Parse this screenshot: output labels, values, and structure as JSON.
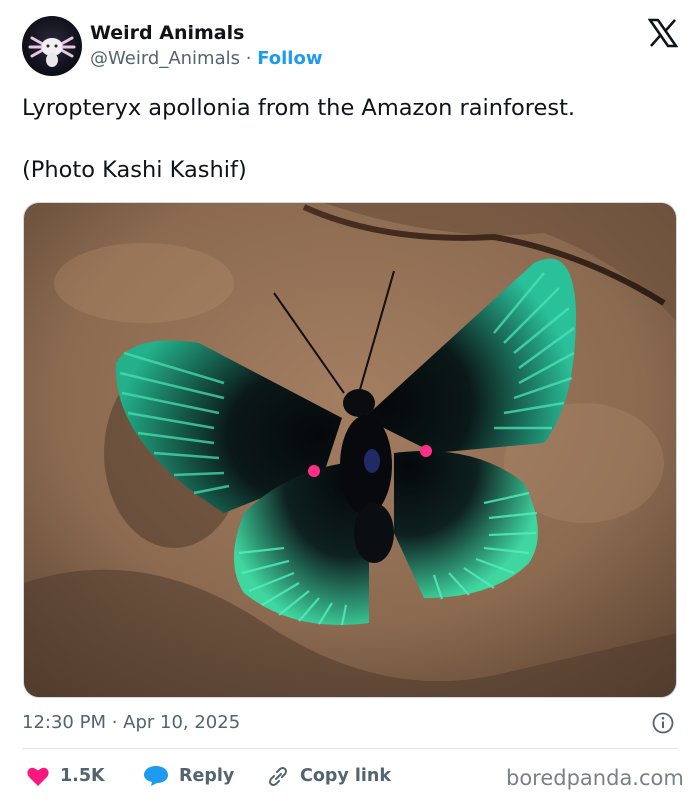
{
  "author": {
    "display_name": "Weird Animals",
    "handle": "@Weird_Animals",
    "separator": "·",
    "follow_label": "Follow"
  },
  "tweet": {
    "text_line_1": "Lyropteryx apollonia from the Amazon rainforest.",
    "text_line_2": "(Photo Kashi Kashif)"
  },
  "meta": {
    "timestamp": "12:30 PM · Apr 10, 2025"
  },
  "actions": {
    "likes_count": "1.5K",
    "reply_label": "Reply",
    "copy_link_label": "Copy link"
  },
  "watermark": "boredpanda.com",
  "colors": {
    "like": "#f91880",
    "reply": "#1d9bf0",
    "follow": "#1d9bf0",
    "wing_iridescent": "#3fd6a0"
  },
  "icons": [
    "x-logo-icon",
    "info-icon",
    "heart-icon",
    "speech-bubble-icon",
    "link-icon"
  ]
}
